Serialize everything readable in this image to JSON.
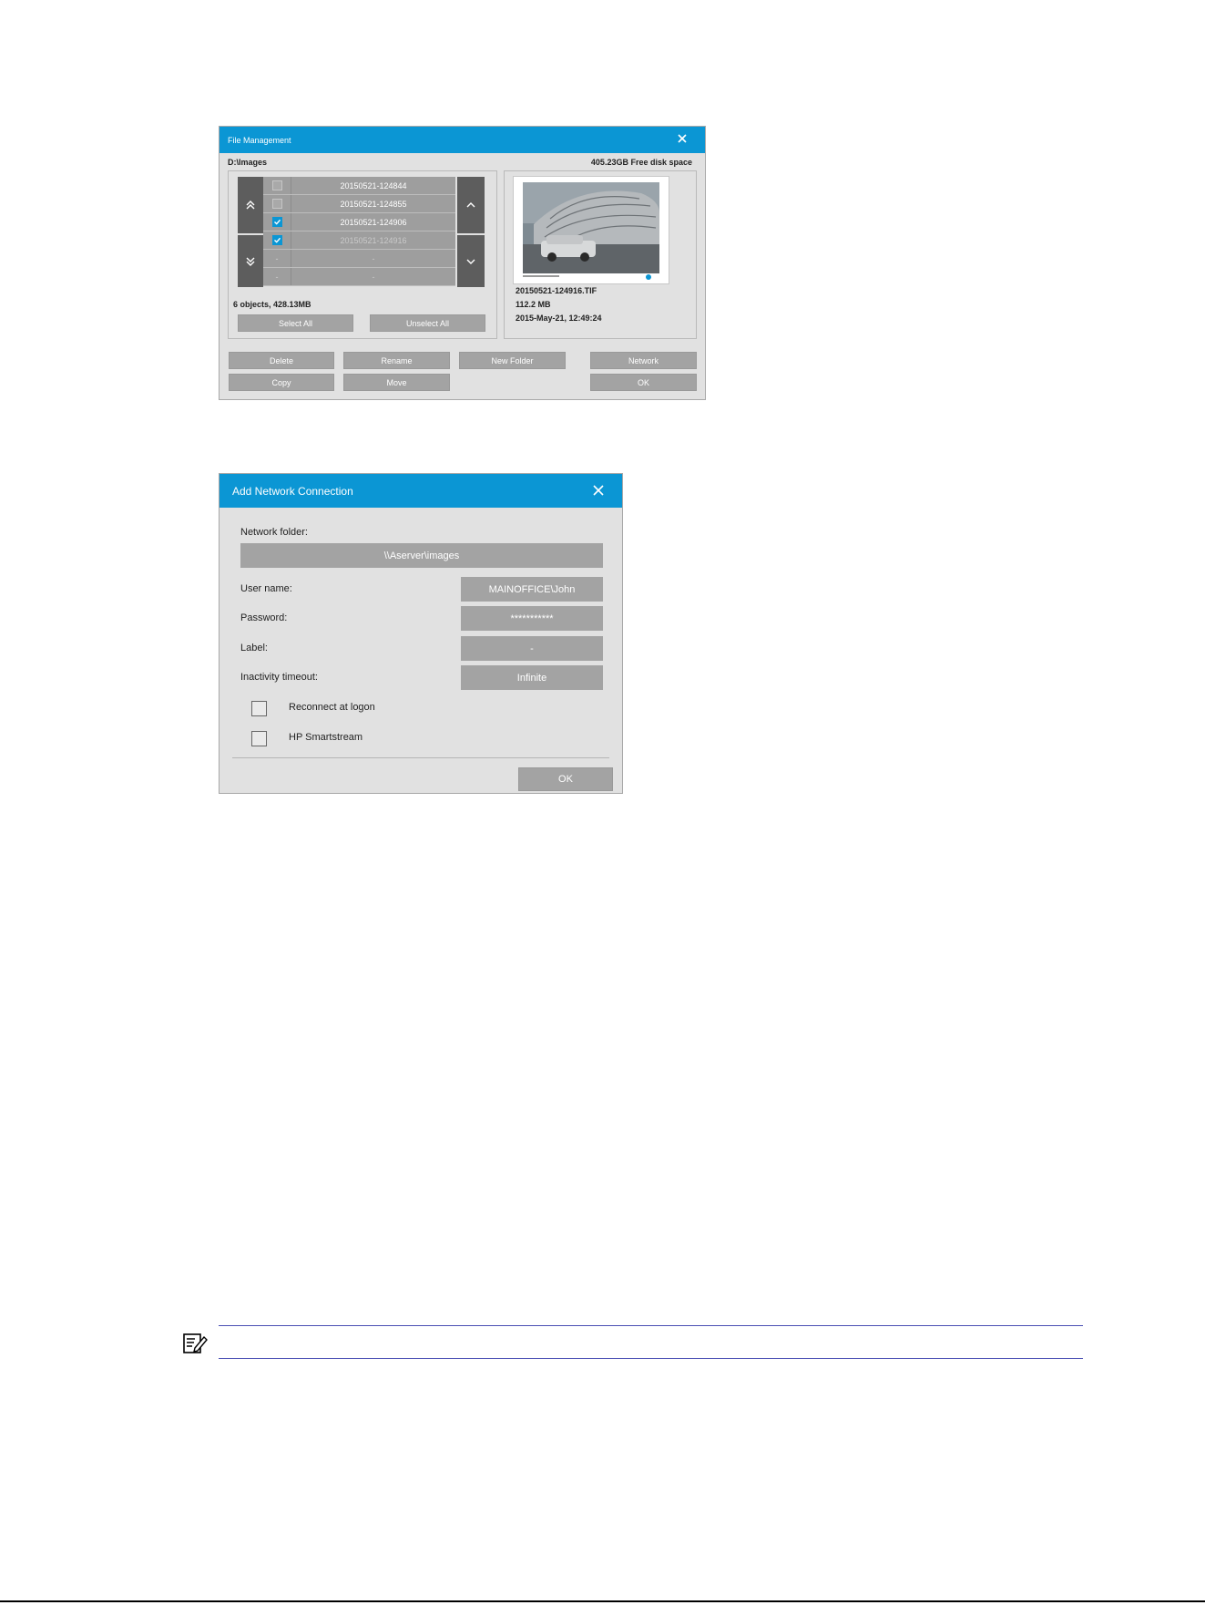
{
  "file_management": {
    "title": "File Management",
    "path": "D:\\Images",
    "free_space": "405.23GB Free disk space",
    "files": [
      {
        "name": "20150521-124844",
        "checked": false
      },
      {
        "name": "20150521-124855",
        "checked": false
      },
      {
        "name": "20150521-124906",
        "checked": true
      },
      {
        "name": "20150521-124916",
        "checked": true
      },
      {
        "name": "-",
        "checked": false
      },
      {
        "name": "-",
        "checked": false
      }
    ],
    "summary": "6 objects, 428.13MB",
    "select_all": "Select All",
    "unselect_all": "Unselect All",
    "preview": {
      "filename": "20150521-124916.TIF",
      "size": "112.2 MB",
      "date": "2015-May-21, 12:49:24"
    },
    "buttons": {
      "delete": "Delete",
      "rename": "Rename",
      "new_folder": "New Folder",
      "network": "Network",
      "copy": "Copy",
      "move": "Move",
      "ok": "OK"
    }
  },
  "network_connection": {
    "title": "Add Network Connection",
    "network_folder_label": "Network folder:",
    "network_folder_value": "\\\\Aserver\\images",
    "user_name_label": "User name:",
    "user_name_value": "MAINOFFICE\\John",
    "password_label": "Password:",
    "password_value": "***********",
    "label_label": "Label:",
    "label_value": "-",
    "inactivity_label": "Inactivity timeout:",
    "inactivity_value": "Infinite",
    "reconnect_label": "Reconnect at logon",
    "reconnect_checked": false,
    "smartstream_label": "HP Smartstream",
    "smartstream_checked": false,
    "ok": "OK"
  },
  "colors": {
    "title_bar": "#0b96d4",
    "dialog_bg": "#e1e1e1",
    "button_gray": "#a3a3a3",
    "note_rule": "#4a4fb4"
  }
}
